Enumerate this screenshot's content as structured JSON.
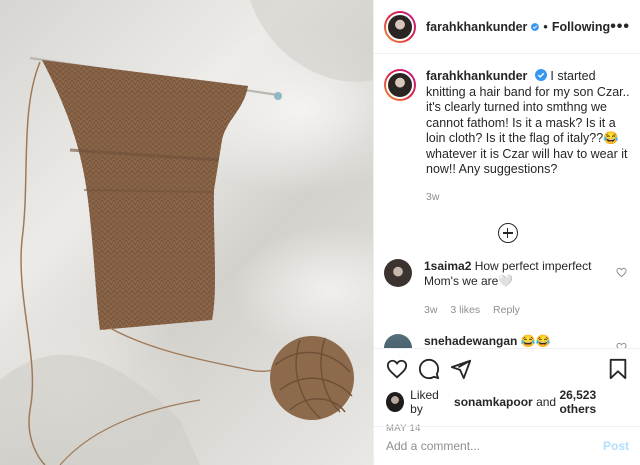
{
  "author": {
    "username": "farahkhankunder",
    "verified": true,
    "separator": "•",
    "follow_status": "Following",
    "more": "•••"
  },
  "caption": {
    "username": "farahkhankunder",
    "text": "I started knitting a hair band for my son Czar.. it's clearly turned into smthng we cannot fathom! Is it a mask? Is it a loin cloth? Is it the flag of italy??😂 whatever it is Czar will hav to wear it now!! Any suggestions?",
    "age": "3w"
  },
  "comments": [
    {
      "username": "1saima2",
      "text": "How perfect imperfect Mom's we are🤍",
      "age": "3w",
      "likes": "3 likes",
      "reply": "Reply"
    },
    {
      "username": "snehadewangan",
      "text": "😂😂"
    }
  ],
  "likes": {
    "prefix": "Liked by",
    "user": "sonamkapoor",
    "and": "and",
    "count": "26,523 others"
  },
  "date": "MAY 14",
  "add_comment": {
    "placeholder": "Add a comment...",
    "post_label": "Post"
  },
  "icons": [
    "heart-icon",
    "comment-icon",
    "share-icon",
    "bookmark-icon",
    "verified-badge-icon",
    "load-more-icon"
  ]
}
